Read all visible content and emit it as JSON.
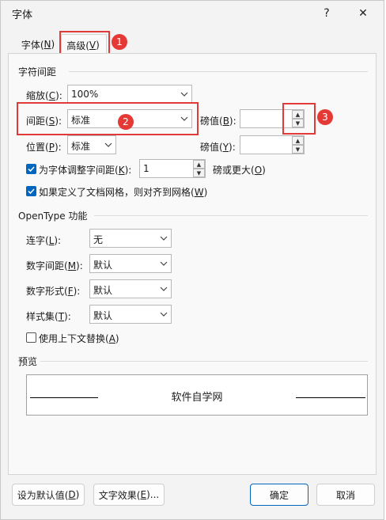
{
  "window": {
    "title": "字体",
    "help_label": "?",
    "close_label": "✕"
  },
  "tabs": [
    {
      "label": "字体(",
      "key": "N",
      "suffix": ")"
    },
    {
      "label": "高级(",
      "key": "V",
      "suffix": ")"
    }
  ],
  "spacing": {
    "header": "字符间距",
    "scale_label": "缩放(",
    "scale_key": "C",
    "scale_suffix": "):",
    "scale_value": "100%",
    "spacing_label": "间距(",
    "spacing_key": "S",
    "spacing_suffix": "):",
    "spacing_value": "标准",
    "spacing_by_label": "磅值(",
    "spacing_by_key": "B",
    "spacing_by_suffix": "):",
    "spacing_by_value": "",
    "position_label": "位置(",
    "position_key": "P",
    "position_suffix": "):",
    "position_value": "标准",
    "position_by_label": "磅值(",
    "position_by_key": "Y",
    "position_by_suffix": "):",
    "position_by_value": "",
    "kerning_label": "为字体调整字间距(",
    "kerning_key": "K",
    "kerning_suffix": "):",
    "kerning_value": "1",
    "kerning_after": "磅或更大(",
    "kerning_after_key": "O",
    "kerning_after_suffix": ")",
    "grid_label": "如果定义了文档网格，则对齐到网格(",
    "grid_key": "W",
    "grid_suffix": ")"
  },
  "opentype": {
    "header": "OpenType 功能",
    "ligatures_label": "连字(",
    "ligatures_key": "L",
    "ligatures_suffix": "):",
    "ligatures_value": "无",
    "numspacing_label": "数字间距(",
    "numspacing_key": "M",
    "numspacing_suffix": "):",
    "numspacing_value": "默认",
    "numforms_label": "数字形式(",
    "numforms_key": "F",
    "numforms_suffix": "):",
    "numforms_value": "默认",
    "stylistic_label": "样式集(",
    "stylistic_key": "T",
    "stylistic_suffix": "):",
    "stylistic_value": "默认",
    "contextual_label": "使用上下文替换(",
    "contextual_key": "A",
    "contextual_suffix": ")"
  },
  "preview": {
    "header": "预览",
    "sample": "软件自学网"
  },
  "buttons": {
    "default_label": "设为默认值(",
    "default_key": "D",
    "default_suffix": ")",
    "effects_label": "文字效果(",
    "effects_key": "E",
    "effects_suffix": ")...",
    "ok": "确定",
    "cancel": "取消"
  },
  "annotations": {
    "one": "1",
    "two": "2",
    "three": "3"
  },
  "colors": {
    "accent": "#0067c0",
    "annotation": "#e53935"
  }
}
